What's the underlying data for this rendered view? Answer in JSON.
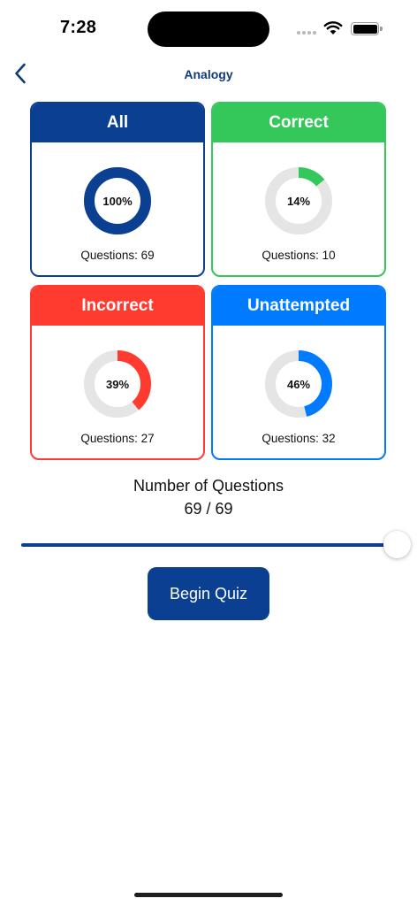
{
  "status_bar": {
    "time": "7:28"
  },
  "nav": {
    "title": "Analogy",
    "back_icon": "chevron-left-icon"
  },
  "colors": {
    "all": "#0b3f91",
    "correct": "#34c759",
    "incorrect": "#ff3b30",
    "unattempted": "#007aff",
    "ring_background": "#e5e5e5"
  },
  "cards": [
    {
      "key": "all",
      "title": "All",
      "percent": 100,
      "percent_label": "100%",
      "count_label": "Questions: 69",
      "color": "#0b3f91"
    },
    {
      "key": "correct",
      "title": "Correct",
      "percent": 14,
      "percent_label": "14%",
      "count_label": "Questions: 10",
      "color": "#34c759"
    },
    {
      "key": "incorrect",
      "title": "Incorrect",
      "percent": 39,
      "percent_label": "39%",
      "count_label": "Questions: 27",
      "color": "#ff3b30"
    },
    {
      "key": "unattempted",
      "title": "Unattempted",
      "percent": 46,
      "percent_label": "46%",
      "count_label": "Questions: 32",
      "color": "#007aff"
    }
  ],
  "question_selector": {
    "label": "Number of Questions",
    "value_text": "69 / 69",
    "current": 69,
    "max": 69,
    "fraction": 1.0
  },
  "begin_button": {
    "label": "Begin Quiz"
  }
}
